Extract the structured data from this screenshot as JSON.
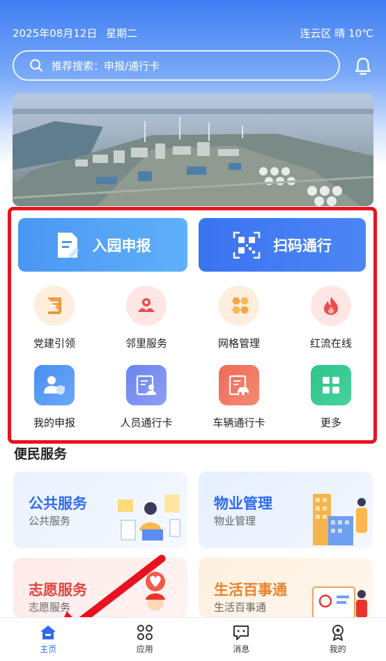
{
  "status": {
    "date": "2025年08月12日",
    "weekday": "星期二",
    "weather": "连云区 晴 10℃"
  },
  "search": {
    "placeholder": "推荐搜索：申报/通行卡"
  },
  "main_actions": [
    {
      "label": "入园申报",
      "icon": "document-edit-icon"
    },
    {
      "label": "扫码通行",
      "icon": "qr-code-icon"
    }
  ],
  "grid_items": [
    {
      "label": "党建引领",
      "icon": "book-icon",
      "color": "#f5a545"
    },
    {
      "label": "邻里服务",
      "icon": "helping-hands-icon",
      "color": "#e84d4d"
    },
    {
      "label": "网格管理",
      "icon": "hexagon-grid-icon",
      "color": "#f5a545"
    },
    {
      "label": "红流在线",
      "icon": "flame-icon",
      "color": "#e84d4d"
    },
    {
      "label": "我的申报",
      "icon": "user-shield-icon",
      "color": "#4a8ff0"
    },
    {
      "label": "人员通行卡",
      "icon": "person-card-icon",
      "color": "#6b84ee"
    },
    {
      "label": "车辆通行卡",
      "icon": "car-card-icon",
      "color": "#ef6a5a"
    },
    {
      "label": "更多",
      "icon": "apps-grid-icon",
      "color": "#2fc38a"
    }
  ],
  "section": {
    "title": "便民服务"
  },
  "service_cards": [
    {
      "title": "公共服务",
      "subtitle": "公共服务",
      "title_color": "#2f6bf0"
    },
    {
      "title": "物业管理",
      "subtitle": "物业管理",
      "title_color": "#2f6bf0"
    },
    {
      "title": "志愿服务",
      "subtitle": "志愿服务",
      "title_color": "#e2453d"
    },
    {
      "title": "生活百事通",
      "subtitle": "生活百事通",
      "title_color": "#e8832a"
    }
  ],
  "tabs": [
    {
      "label": "主页",
      "icon": "home-icon",
      "active": true
    },
    {
      "label": "应用",
      "icon": "apps-icon"
    },
    {
      "label": "消息",
      "icon": "message-icon"
    },
    {
      "label": "我的",
      "icon": "profile-icon"
    }
  ],
  "colors": {
    "accent": "#2f6bf0",
    "highlight": "#e8121f"
  }
}
